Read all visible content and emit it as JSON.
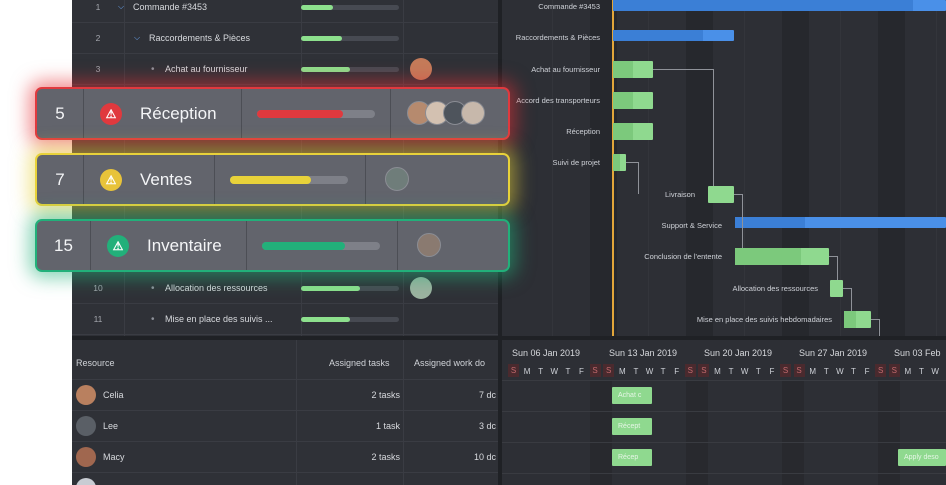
{
  "tasks": [
    {
      "num": "1",
      "name": "Commande #3453",
      "level": 0,
      "caret": "v",
      "progress": 0.33
    },
    {
      "num": "2",
      "name": "Raccordements & Pièces",
      "level": 1,
      "caret": "v",
      "progress": 0.42
    },
    {
      "num": "3",
      "name": "Achat au fournisseur",
      "level": 2,
      "progress": 0.5,
      "avatar": "#c47b5a"
    },
    {
      "num": "10",
      "name": "Allocation des ressources",
      "level": 2,
      "progress": 0.6,
      "avatar": "#9cb3a0"
    },
    {
      "num": "11",
      "name": "Mise en place des suivis ...",
      "level": 2,
      "progress": 0.5
    }
  ],
  "gantt": {
    "labels": [
      "Commande #3453",
      "Raccordements & Pièces",
      "Achat au fournisseur",
      "Accord des transporteurs",
      "Réception",
      "Suivi de projet",
      "Livraison",
      "Support & Service",
      "Conclusion de l'entente",
      "Allocation des ressources",
      "Mise en place des suivis hebdomadaires"
    ]
  },
  "resources": {
    "headers": {
      "resource": "Resource",
      "tasks": "Assigned tasks",
      "work": "Assigned work do"
    },
    "rows": [
      {
        "name": "Celia",
        "tasks": "2 tasks",
        "work": "7 dc",
        "avatar": "#b9805f"
      },
      {
        "name": "Lee",
        "tasks": "1 task",
        "work": "3 dc",
        "avatar": "#5a5f66"
      },
      {
        "name": "Macy",
        "tasks": "2 tasks",
        "work": "10 dc",
        "avatar": "#a0674f"
      }
    ]
  },
  "timeline": {
    "weeks": [
      "Sun 06 Jan 2019",
      "Sun 13 Jan 2019",
      "Sun 20 Jan 2019",
      "Sun 27 Jan 2019",
      "Sun 03 Feb"
    ],
    "days": [
      "S",
      "M",
      "T",
      "W",
      "T",
      "F",
      "S",
      "S",
      "M",
      "T",
      "W",
      "T",
      "F",
      "S",
      "S",
      "M",
      "T",
      "W",
      "T",
      "F",
      "S",
      "S",
      "M",
      "T",
      "W",
      "T",
      "F",
      "S",
      "S",
      "M",
      "T",
      "W",
      "T"
    ],
    "chips": [
      "Achat c",
      "Récept",
      "Récep",
      "Apply deso"
    ]
  },
  "cards": [
    {
      "num": "5",
      "title": "Réception",
      "icon": "warning-triangle",
      "accent": "#e0393e",
      "progress": 0.73
    },
    {
      "num": "7",
      "title": "Ventes",
      "icon": "warning-triangle",
      "accent": "#e8d23a",
      "progress": 0.69
    },
    {
      "num": "15",
      "title": "Inventaire",
      "icon": "warning-triangle",
      "accent": "#22b07a",
      "progress": 0.7
    }
  ]
}
